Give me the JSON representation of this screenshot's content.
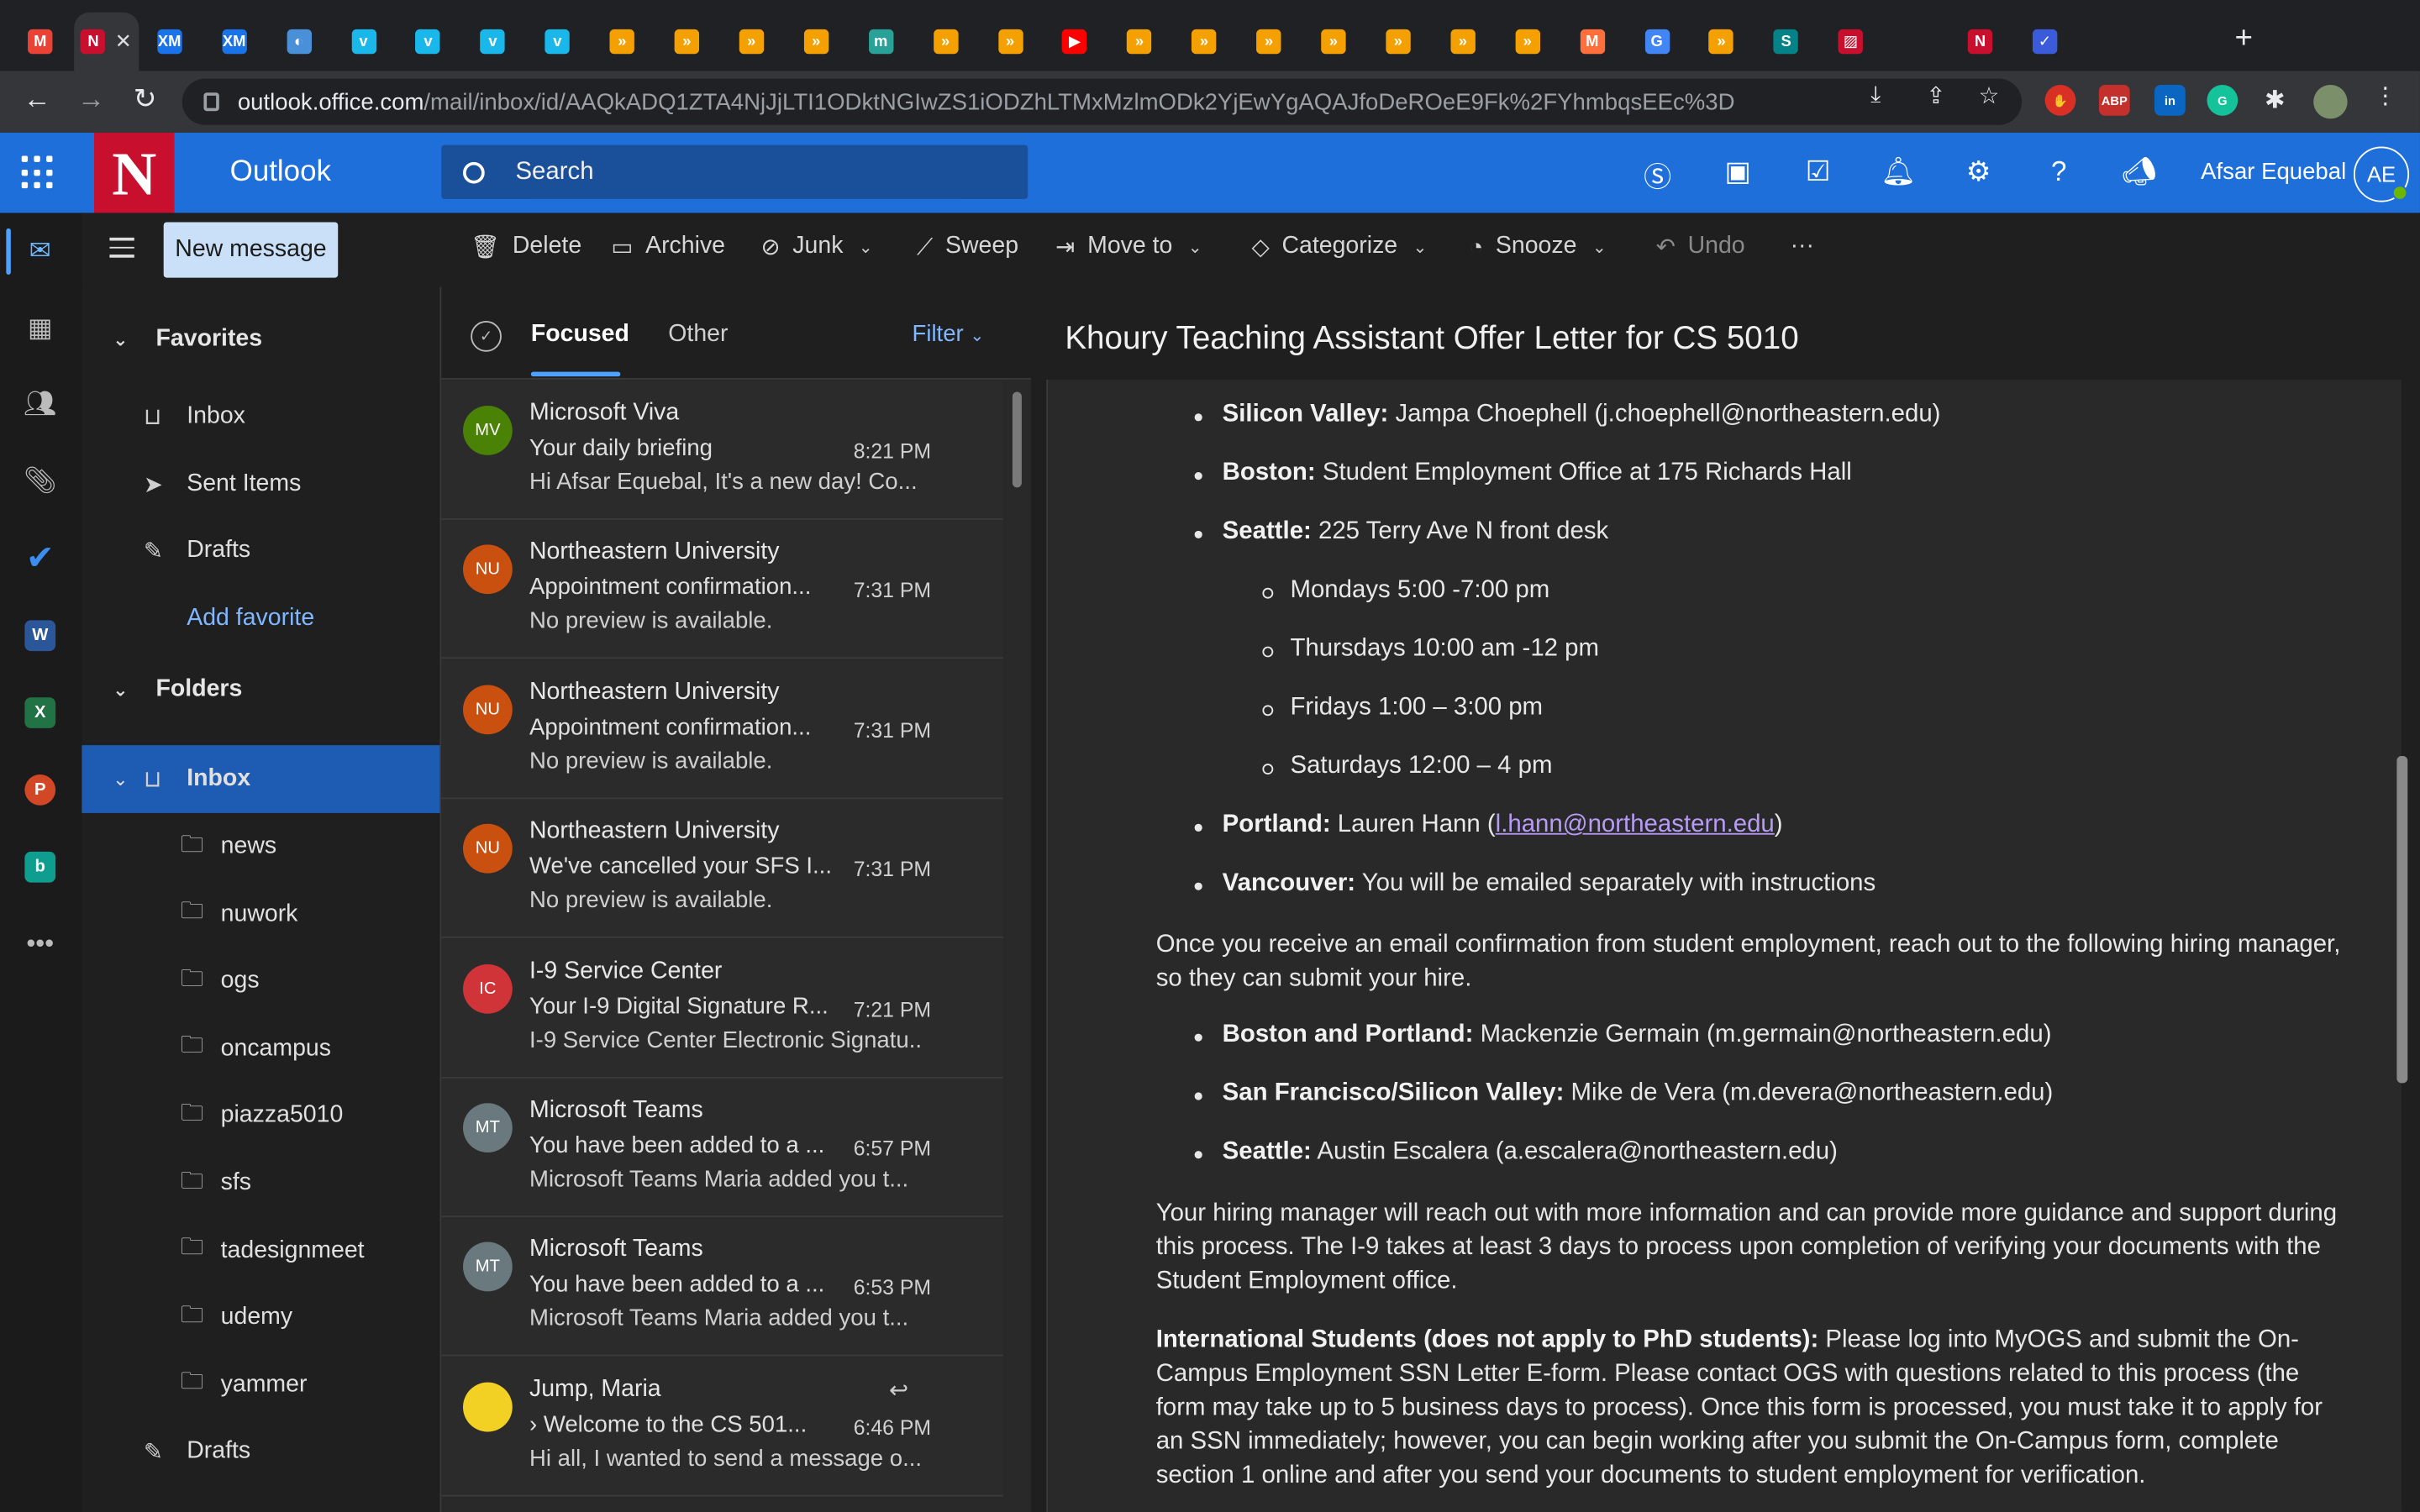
{
  "browser": {
    "url_host": "outlook.office.com",
    "url_path": "/mail/inbox/id/AAQkADQ1ZTA4NjJjLTI1ODktNGIwZS1iODZhLTMxMzlmODk2YjEwYgAQAJfoDeROeE9Fk%2FYhmbqsEEc%3D",
    "tabs": [
      {
        "label": "M",
        "color": "#ea4335"
      },
      {
        "label": "N",
        "color": "#c8102e",
        "active": true
      },
      {
        "label": "XM",
        "color": "#1a73e8"
      },
      {
        "label": "XM",
        "color": "#1a73e8"
      },
      {
        "label": "◐",
        "color": "#4a90d9"
      },
      {
        "label": "v",
        "color": "#1ab7ea"
      },
      {
        "label": "v",
        "color": "#1ab7ea"
      },
      {
        "label": "v",
        "color": "#1ab7ea"
      },
      {
        "label": "v",
        "color": "#1ab7ea"
      },
      {
        "label": "»",
        "color": "#f4a000"
      },
      {
        "label": "»",
        "color": "#f4a000"
      },
      {
        "label": "»",
        "color": "#f4a000"
      },
      {
        "label": "»",
        "color": "#f4a000"
      },
      {
        "label": "m",
        "color": "#2aa198"
      },
      {
        "label": "»",
        "color": "#f4a000"
      },
      {
        "label": "»",
        "color": "#f4a000"
      },
      {
        "label": "▶",
        "color": "#ff0000"
      },
      {
        "label": "»",
        "color": "#f4a000"
      },
      {
        "label": "»",
        "color": "#f4a000"
      },
      {
        "label": "»",
        "color": "#f4a000"
      },
      {
        "label": "»",
        "color": "#f4a000"
      },
      {
        "label": "»",
        "color": "#f4a000"
      },
      {
        "label": "»",
        "color": "#f4a000"
      },
      {
        "label": "»",
        "color": "#f4a000"
      },
      {
        "label": "M",
        "color": "#ff6f3c"
      },
      {
        "label": "G",
        "color": "#4285f4"
      },
      {
        "label": "»",
        "color": "#f4a000"
      },
      {
        "label": "S",
        "color": "#038387"
      },
      {
        "label": "▨",
        "color": "#c8102e"
      },
      {
        "label": "",
        "color": "#202124"
      },
      {
        "label": "N",
        "color": "#c8102e"
      },
      {
        "label": "✓",
        "color": "#3b5bdb"
      }
    ]
  },
  "header": {
    "app_name": "Outlook",
    "logo_letter": "N",
    "search_placeholder": "Search",
    "user_name": "Afsar Equebal",
    "user_initials": "AE"
  },
  "commands": {
    "new_message": "New message",
    "delete": "Delete",
    "archive": "Archive",
    "junk": "Junk",
    "sweep": "Sweep",
    "move_to": "Move to",
    "categorize": "Categorize",
    "snooze": "Snooze",
    "undo": "Undo",
    "more": "···"
  },
  "folders": {
    "favorites_label": "Favorites",
    "favorites": [
      {
        "label": "Inbox",
        "icon": "inbox-icon"
      },
      {
        "label": "Sent Items",
        "icon": "send-icon"
      },
      {
        "label": "Drafts",
        "icon": "pencil-icon"
      }
    ],
    "add_favorite": "Add favorite",
    "folders_label": "Folders",
    "inbox": "Inbox",
    "subfolders": [
      "news",
      "nuwork",
      "ogs",
      "oncampus",
      "piazza5010",
      "sfs",
      "tadesignmeet",
      "udemy",
      "yammer"
    ],
    "drafts": "Drafts"
  },
  "message_list": {
    "tab_focused": "Focused",
    "tab_other": "Other",
    "filter": "Filter",
    "messages": [
      {
        "initials": "MV",
        "color": "#498205",
        "sender": "Microsoft Viva",
        "subject": "Your daily briefing",
        "time": "8:21 PM",
        "preview": "Hi Afsar Equebal, It's a new day! Co..."
      },
      {
        "initials": "NU",
        "color": "#ca5010",
        "sender": "Northeastern University",
        "subject": "Appointment confirmation...",
        "time": "7:31 PM",
        "preview": "No preview is available."
      },
      {
        "initials": "NU",
        "color": "#ca5010",
        "sender": "Northeastern University",
        "subject": "Appointment confirmation...",
        "time": "7:31 PM",
        "preview": "No preview is available."
      },
      {
        "initials": "NU",
        "color": "#ca5010",
        "sender": "Northeastern University",
        "subject": "We've cancelled your SFS I...",
        "time": "7:31 PM",
        "preview": "No preview is available."
      },
      {
        "initials": "IC",
        "color": "#d13438",
        "sender": "I-9 Service Center",
        "subject": "Your I-9 Digital Signature R...",
        "time": "7:21 PM",
        "preview": "I-9 Service Center Electronic Signatu..."
      },
      {
        "initials": "MT",
        "color": "#69797e",
        "sender": "Microsoft Teams",
        "subject": "You have been added to a ...",
        "time": "6:57 PM",
        "preview": "Microsoft Teams Maria added you t..."
      },
      {
        "initials": "MT",
        "color": "#69797e",
        "sender": "Microsoft Teams",
        "subject": "You have been added to a ...",
        "time": "6:53 PM",
        "preview": "Microsoft Teams Maria added you t..."
      },
      {
        "initials": "",
        "color": "#f2d024",
        "sender": "Jump, Maria",
        "subject": "Welcome to the CS 501...",
        "time": "6:46 PM",
        "preview": "Hi all, I wanted to send a message o..."
      }
    ]
  },
  "reading": {
    "title": "Khoury Teaching Assistant Offer Letter for CS 5010",
    "locations": [
      {
        "bold": "Silicon Valley:",
        "text": " Jampa Choephell (j.choephell@northeastern.edu)"
      },
      {
        "bold": "Boston:",
        "text": " Student Employment Office at 175 Richards Hall"
      },
      {
        "bold": "Seattle:",
        "text": " 225 Terry Ave N front desk"
      }
    ],
    "seattle_hours": [
      "Mondays 5:00 -7:00 pm",
      "Thursdays 10:00 am -12 pm",
      "Fridays 1:00 – 3:00 pm",
      "Saturdays 12:00 – 4 pm"
    ],
    "portland_bold": "Portland:",
    "portland_text": " Lauren Hann (",
    "portland_link": "l.hann@northeastern.edu",
    "portland_close": ")",
    "vancouver_bold": "Vancouver:",
    "vancouver_text": " You will be emailed separately with instructions",
    "para1": "Once you receive an email confirmation from student employment, reach out to the following hiring manager, so they can submit your hire.",
    "managers": [
      {
        "bold": "Boston and Portland:",
        "text": " Mackenzie Germain (m.germain@northeastern.edu)"
      },
      {
        "bold": "San Francisco/Silicon Valley:",
        "text": " Mike de Vera (m.devera@northeastern.edu)"
      },
      {
        "bold": "Seattle:",
        "text": " Austin Escalera (a.escalera@northeastern.edu)"
      }
    ],
    "para2": "Your hiring manager will reach out with more information and can provide more guidance and support during this process. The I-9 takes at least 3 days to process upon completion of verifying your documents with the Student Employment office.",
    "para3_bold": "International Students (does not apply to PhD students):",
    "para3": " Please log into MyOGS and submit the On-Campus Employment SSN Letter E-form. Please contact OGS with questions related to this process (the form may take up to 5 business days to process). Once this form is processed, you must take it to apply for an SSN immediately; however, you can begin working after you submit the On-Campus form, complete section 1 online and after you send your documents to student employment for verification."
  }
}
